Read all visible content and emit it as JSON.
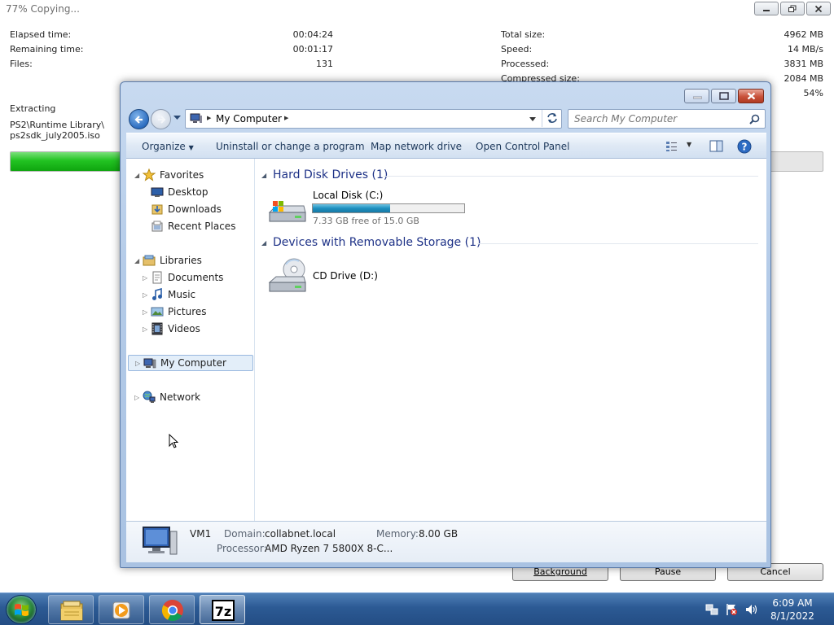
{
  "zip": {
    "title": "77% Copying...",
    "stats_left": [
      {
        "label": "Elapsed time:",
        "value": "00:04:24"
      },
      {
        "label": "Remaining time:",
        "value": "00:01:17"
      },
      {
        "label": "Files:",
        "value": "131"
      }
    ],
    "stats_right": [
      {
        "label": "Total size:",
        "value": "4962 MB"
      },
      {
        "label": "Speed:",
        "value": "14 MB/s"
      },
      {
        "label": "Processed:",
        "value": "3831 MB"
      },
      {
        "label": "Compressed size:",
        "value": "2084 MB"
      },
      {
        "label": "",
        "value": "54%"
      }
    ],
    "operation": "Extracting",
    "path_line1": "PS2\\Runtime Library\\",
    "path_line2": "ps2sdk_july2005.iso",
    "progress_fraction": 0.77,
    "buttons": {
      "background": "Background",
      "pause": "Pause",
      "cancel": "Cancel"
    }
  },
  "explorer": {
    "address": {
      "crumb": "My Computer"
    },
    "search_placeholder": "Search My Computer",
    "toolbar": {
      "organize": "Organize",
      "uninstall": "Uninstall or change a program",
      "map_drive": "Map network drive",
      "control_panel": "Open Control Panel"
    },
    "nav": {
      "favorites": "Favorites",
      "desktop": "Desktop",
      "downloads": "Downloads",
      "recent_places": "Recent Places",
      "libraries": "Libraries",
      "documents": "Documents",
      "music": "Music",
      "pictures": "Pictures",
      "videos": "Videos",
      "my_computer": "My Computer",
      "network": "Network"
    },
    "groups": {
      "hard_disks": "Hard Disk Drives (1)",
      "removable": "Devices with Removable Storage (1)"
    },
    "drives": {
      "c_name": "Local Disk (C:)",
      "c_free": "7.33 GB free of 15.0 GB",
      "c_used_fraction": 0.51,
      "d_name": "CD Drive (D:)"
    },
    "details": {
      "computer_name": "VM1",
      "domain_label": "Domain:",
      "domain_value": "collabnet.local",
      "memory_label": "Memory:",
      "memory_value": "8.00 GB",
      "processor_label": "Processor:",
      "processor_value": "AMD Ryzen 7 5800X 8-C..."
    }
  },
  "taskbar": {
    "time": "6:09 AM",
    "date": "8/1/2022",
    "apps": [
      "explorer-icon",
      "media-player-icon",
      "chrome-icon",
      "7zip-icon"
    ]
  }
}
